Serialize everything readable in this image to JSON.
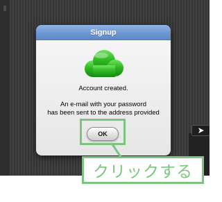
{
  "dialog": {
    "title": "Signup",
    "icon": "cloud-icon",
    "message": "Account created.",
    "detail_line1": "An e-mail with your password",
    "detail_line2": "has been sent to the address provided",
    "ok_label": "OK"
  },
  "side_panel": {
    "toggle_icon": "play-arrow-icon"
  },
  "annotation": {
    "label": "クリックする"
  },
  "colors": {
    "title_bar": "#6f97d2",
    "cloud_green": "#22a51c",
    "highlight_green": "#7cc47f",
    "background_dark": "#3a3a3a"
  }
}
